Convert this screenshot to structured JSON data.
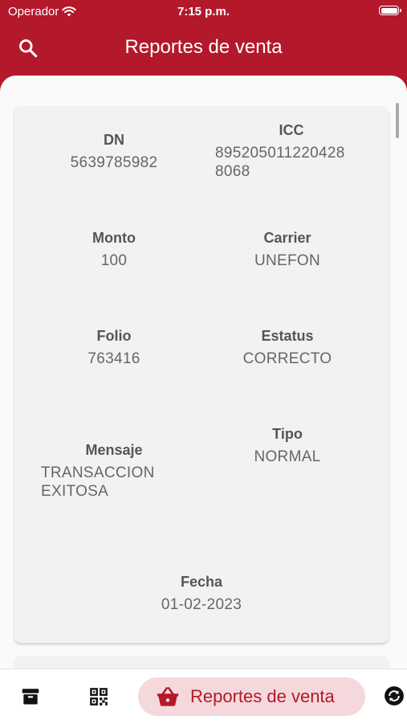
{
  "status_bar": {
    "carrier": "Operador",
    "time": "7:15 p.m."
  },
  "app_bar": {
    "title": "Reportes de venta"
  },
  "report": {
    "dn": {
      "label": "DN",
      "value": "5639785982"
    },
    "icc": {
      "label": "ICC",
      "value_line1": "895205011220428",
      "value_line2": "8068"
    },
    "monto": {
      "label": "Monto",
      "value": "100"
    },
    "carrier": {
      "label": "Carrier",
      "value": "UNEFON"
    },
    "folio": {
      "label": "Folio",
      "value": "763416"
    },
    "estatus": {
      "label": "Estatus",
      "value": "CORRECTO"
    },
    "mensaje": {
      "label": "Mensaje",
      "value_line1": "TRANSACCION",
      "value_line2": "EXITOSA"
    },
    "tipo": {
      "label": "Tipo",
      "value": "NORMAL"
    },
    "fecha": {
      "label": "Fecha",
      "value": "01-02-2023"
    }
  },
  "bottom_nav": {
    "items": [
      {
        "icon": "archive-icon"
      },
      {
        "icon": "qr-code-icon"
      },
      {
        "icon": "shopping-basket-icon",
        "label": "Reportes de venta",
        "active": true
      },
      {
        "icon": "sync-icon"
      }
    ]
  },
  "colors": {
    "primary": "#b3182b",
    "active_pill": "#f5d8db",
    "card": "#f2f2f2"
  }
}
